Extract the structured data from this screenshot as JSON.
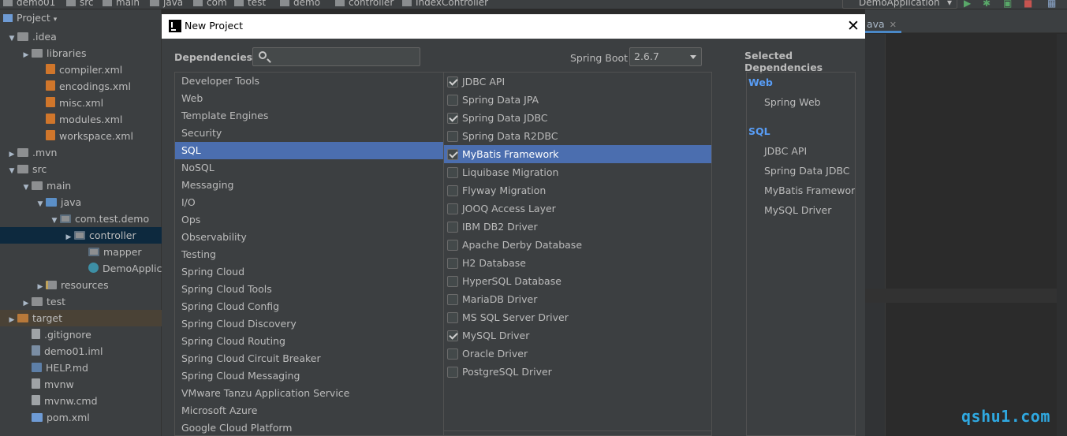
{
  "ide": {
    "breadcrumbs": [
      "demo01",
      "src",
      "main",
      "java",
      "com",
      "test",
      "demo",
      "controller",
      "IndexController"
    ],
    "run_config": "DemoApplication",
    "project_panel_title": "Project",
    "editor_tab": "ava",
    "tree": [
      {
        "label": ".idea",
        "indent": 0,
        "arrow": "▼",
        "icon": "folder"
      },
      {
        "label": "libraries",
        "indent": 1,
        "arrow": "▶",
        "icon": "folder"
      },
      {
        "label": "compiler.xml",
        "indent": 2,
        "arrow": "",
        "icon": "xml"
      },
      {
        "label": "encodings.xml",
        "indent": 2,
        "arrow": "",
        "icon": "xml"
      },
      {
        "label": "misc.xml",
        "indent": 2,
        "arrow": "",
        "icon": "xml"
      },
      {
        "label": "modules.xml",
        "indent": 2,
        "arrow": "",
        "icon": "xml"
      },
      {
        "label": "workspace.xml",
        "indent": 2,
        "arrow": "",
        "icon": "xml"
      },
      {
        "label": ".mvn",
        "indent": 0,
        "arrow": "▶",
        "icon": "folder"
      },
      {
        "label": "src",
        "indent": 0,
        "arrow": "▼",
        "icon": "folder"
      },
      {
        "label": "main",
        "indent": 1,
        "arrow": "▼",
        "icon": "folder"
      },
      {
        "label": "java",
        "indent": 2,
        "arrow": "▼",
        "icon": "folder-blue"
      },
      {
        "label": "com.test.demo",
        "indent": 3,
        "arrow": "▼",
        "icon": "pkg"
      },
      {
        "label": "controller",
        "indent": 4,
        "arrow": "▶",
        "icon": "pkg",
        "selected": true
      },
      {
        "label": "mapper",
        "indent": 5,
        "arrow": "",
        "icon": "pkg"
      },
      {
        "label": "DemoApplicati",
        "indent": 5,
        "arrow": "",
        "icon": "cls"
      },
      {
        "label": "resources",
        "indent": 2,
        "arrow": "▶",
        "icon": "folder-res"
      },
      {
        "label": "test",
        "indent": 1,
        "arrow": "▶",
        "icon": "folder"
      },
      {
        "label": "target",
        "indent": 0,
        "arrow": "▶",
        "icon": "folder-orange",
        "highlight": true
      },
      {
        "label": ".gitignore",
        "indent": 1,
        "arrow": "",
        "icon": "file"
      },
      {
        "label": "demo01.iml",
        "indent": 1,
        "arrow": "",
        "icon": "iml"
      },
      {
        "label": "HELP.md",
        "indent": 1,
        "arrow": "",
        "icon": "md"
      },
      {
        "label": "mvnw",
        "indent": 1,
        "arrow": "",
        "icon": "file"
      },
      {
        "label": "mvnw.cmd",
        "indent": 1,
        "arrow": "",
        "icon": "file"
      },
      {
        "label": "pom.xml",
        "indent": 1,
        "arrow": "",
        "icon": "mod"
      }
    ]
  },
  "dialog": {
    "title": "New Project",
    "dependencies_label": "Dependencies",
    "search": {
      "value": "",
      "placeholder": ""
    },
    "spring_boot_label": "Spring Boot",
    "spring_boot_version": "2.6.7",
    "categories": [
      "Developer Tools",
      "Web",
      "Template Engines",
      "Security",
      "SQL",
      "NoSQL",
      "Messaging",
      "I/O",
      "Ops",
      "Observability",
      "Testing",
      "Spring Cloud",
      "Spring Cloud Tools",
      "Spring Cloud Config",
      "Spring Cloud Discovery",
      "Spring Cloud Routing",
      "Spring Cloud Circuit Breaker",
      "Spring Cloud Messaging",
      "VMware Tanzu Application Service",
      "Microsoft Azure",
      "Google Cloud Platform"
    ],
    "selected_category": "SQL",
    "dependencies": [
      {
        "label": "JDBC API",
        "checked": true
      },
      {
        "label": "Spring Data JPA",
        "checked": false
      },
      {
        "label": "Spring Data JDBC",
        "checked": true
      },
      {
        "label": "Spring Data R2DBC",
        "checked": false
      },
      {
        "label": "MyBatis Framework",
        "checked": true,
        "selected": true
      },
      {
        "label": "Liquibase Migration",
        "checked": false
      },
      {
        "label": "Flyway Migration",
        "checked": false
      },
      {
        "label": "JOOQ Access Layer",
        "checked": false
      },
      {
        "label": "IBM DB2 Driver",
        "checked": false
      },
      {
        "label": "Apache Derby Database",
        "checked": false
      },
      {
        "label": "H2 Database",
        "checked": false
      },
      {
        "label": "HyperSQL Database",
        "checked": false
      },
      {
        "label": "MariaDB Driver",
        "checked": false
      },
      {
        "label": "MS SQL Server Driver",
        "checked": false
      },
      {
        "label": "MySQL Driver",
        "checked": true
      },
      {
        "label": "Oracle Driver",
        "checked": false
      },
      {
        "label": "PostgreSQL Driver",
        "checked": false
      }
    ],
    "selected_title": "Selected Dependencies",
    "selected_groups": [
      {
        "name": "Web",
        "items": [
          "Spring Web"
        ]
      },
      {
        "name": "SQL",
        "items": [
          "JDBC API",
          "Spring Data JDBC",
          "MyBatis Framework",
          "MySQL Driver"
        ]
      }
    ]
  },
  "watermark": "qshu1.com",
  "colors": {
    "selection": "#4b6eaf",
    "group_heading": "#589df6",
    "watermark": "#2fa8e0"
  }
}
